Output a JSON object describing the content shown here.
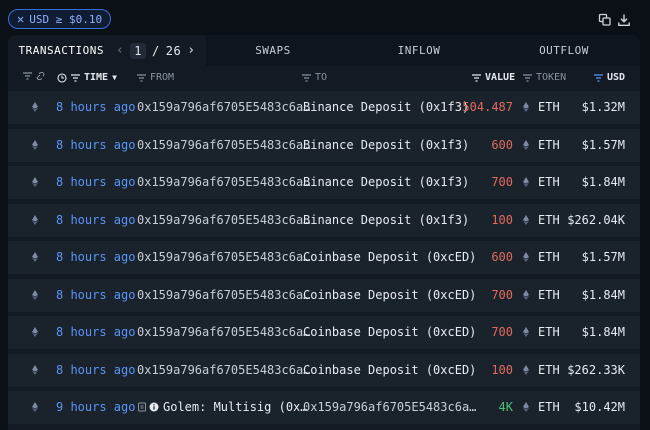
{
  "filter_chip": {
    "close": "✕",
    "label": "USD ≥ $0.10"
  },
  "toolbar": {
    "copy_icon": "copy-icon",
    "download_icon": "download-icon"
  },
  "tabs": {
    "transactions": "TRANSACTIONS",
    "page_current": "1",
    "page_sep": "/",
    "page_total": "26",
    "swaps": "SWAPS",
    "inflow": "INFLOW",
    "outflow": "OUTFLOW"
  },
  "columns": {
    "time": "TIME",
    "from": "FROM",
    "to": "TO",
    "value": "VALUE",
    "token": "TOKEN",
    "usd": "USD"
  },
  "colors": {
    "accent": "#5a95f5",
    "outflow_value": "#e36a5d",
    "inflow_value": "#4fbf73"
  },
  "rows": [
    {
      "time": "8 hours ago",
      "from": "0x159a796af6705E5483c6a…",
      "to": "Binance Deposit (0x1f3)",
      "value": "504.487",
      "token": "ETH",
      "usd": "$1.32M"
    },
    {
      "time": "8 hours ago",
      "from": "0x159a796af6705E5483c6a…",
      "to": "Binance Deposit (0x1f3)",
      "value": "600",
      "token": "ETH",
      "usd": "$1.57M"
    },
    {
      "time": "8 hours ago",
      "from": "0x159a796af6705E5483c6a…",
      "to": "Binance Deposit (0x1f3)",
      "value": "700",
      "token": "ETH",
      "usd": "$1.84M"
    },
    {
      "time": "8 hours ago",
      "from": "0x159a796af6705E5483c6a…",
      "to": "Binance Deposit (0x1f3)",
      "value": "100",
      "token": "ETH",
      "usd": "$262.04K"
    },
    {
      "time": "8 hours ago",
      "from": "0x159a796af6705E5483c6a…",
      "to": "Coinbase Deposit (0xcED)",
      "value": "600",
      "token": "ETH",
      "usd": "$1.57M"
    },
    {
      "time": "8 hours ago",
      "from": "0x159a796af6705E5483c6a…",
      "to": "Coinbase Deposit (0xcED)",
      "value": "700",
      "token": "ETH",
      "usd": "$1.84M"
    },
    {
      "time": "8 hours ago",
      "from": "0x159a796af6705E5483c6a…",
      "to": "Coinbase Deposit (0xcED)",
      "value": "700",
      "token": "ETH",
      "usd": "$1.84M"
    },
    {
      "time": "8 hours ago",
      "from": "0x159a796af6705E5483c6a…",
      "to": "Coinbase Deposit (0xcED)",
      "value": "100",
      "token": "ETH",
      "usd": "$262.33K"
    },
    {
      "time": "9 hours ago",
      "from": "Golem: Multisig (0x…",
      "to": "0x159a796af6705E5483c6a…",
      "value": "4K",
      "token": "ETH",
      "usd": "$10.42M"
    }
  ]
}
